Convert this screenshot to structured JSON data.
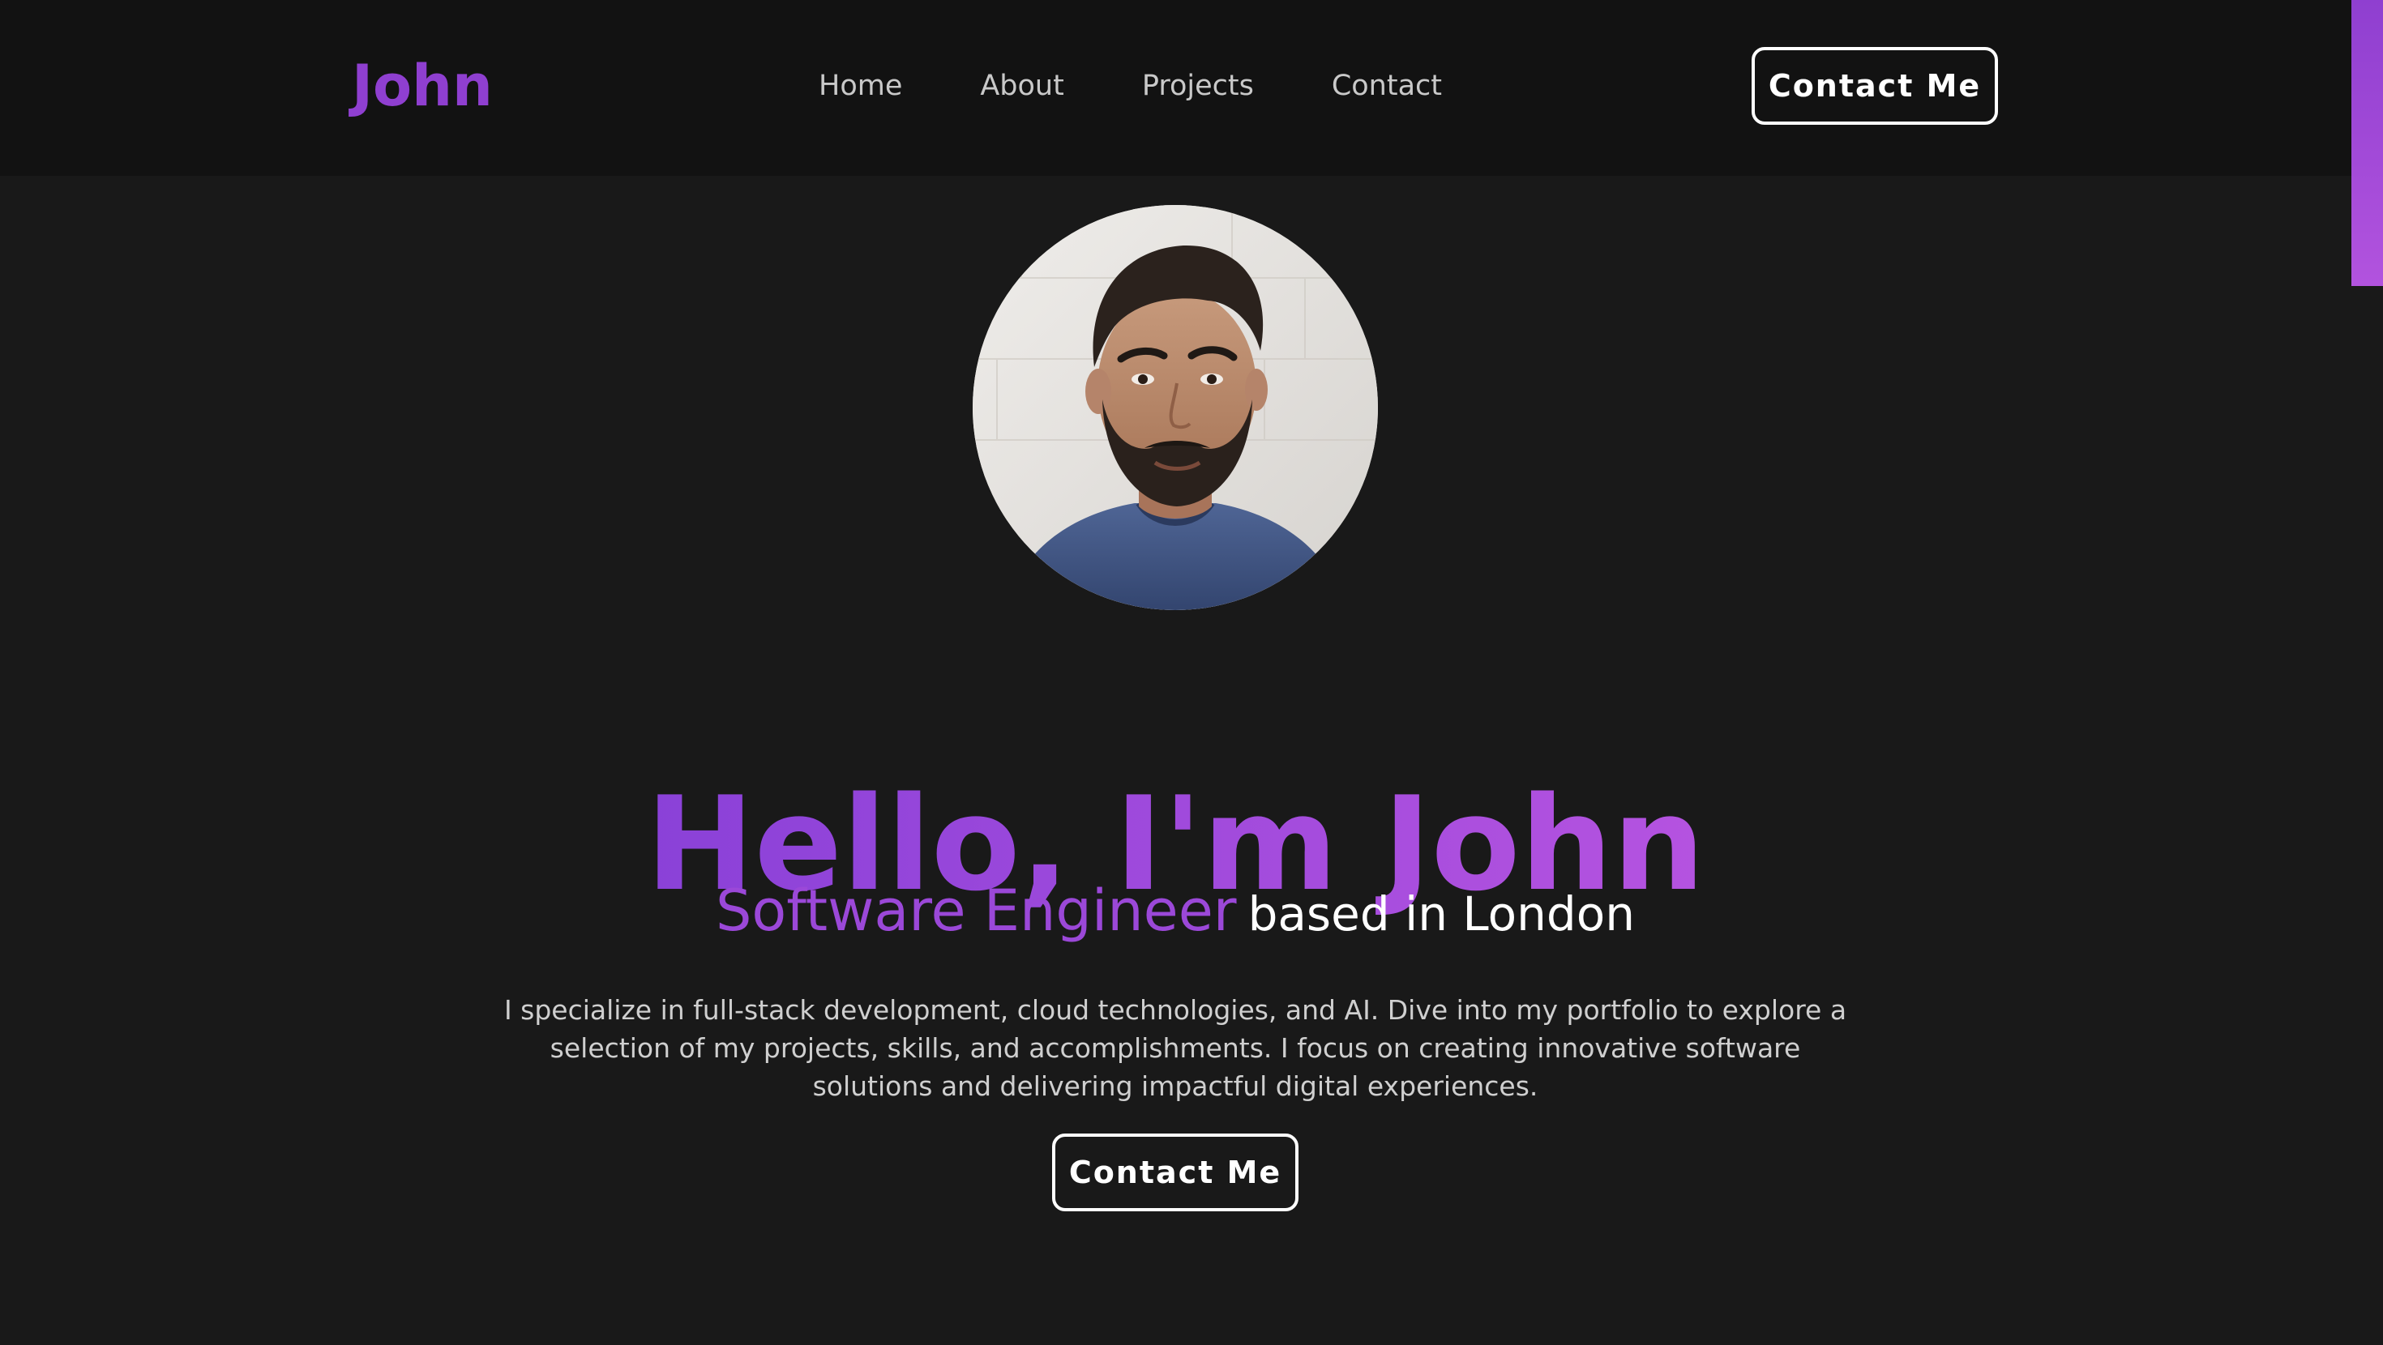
{
  "nav": {
    "logo": "John",
    "links": [
      "Home",
      "About",
      "Projects",
      "Contact"
    ],
    "contact_button": "Contact Me"
  },
  "hero": {
    "avatar": "portrait-photo",
    "title": "Hello, I'm John",
    "role": "Software Engineer",
    "location": "based in London",
    "description": "I specialize in full-stack development, cloud technologies, and AI. Dive into my portfolio to explore a selection of my projects, skills, and accomplishments. I focus on creating innovative software solutions and delivering impactful digital experiences.",
    "contact_button": "Contact Me"
  },
  "colors": {
    "background": "#191919",
    "navbar": "#121212",
    "accent": "#8f3fd0",
    "accent_light": "#b553e0"
  }
}
